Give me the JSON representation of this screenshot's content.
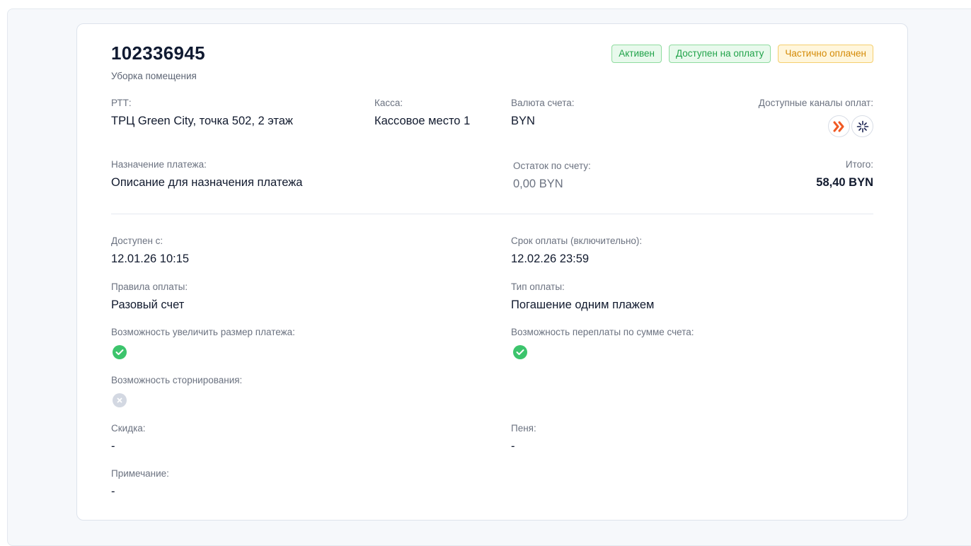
{
  "invoice": {
    "number": "102336945",
    "title": "Уборка помещения"
  },
  "badges": [
    {
      "label": "Активен",
      "color": "#21a34a"
    },
    {
      "label": "Доступен на оплату",
      "color": "#21a34a"
    },
    {
      "label": "Частично оплачен",
      "color": "#d48a06"
    }
  ],
  "fields": {
    "rtt": {
      "label": "РТТ:",
      "value": "ТРЦ Green City, точка 502, 2 этаж"
    },
    "kassa": {
      "label": "Касса:",
      "value": "Кассовое место 1"
    },
    "currency": {
      "label": "Валюта счета:",
      "value": "BYN"
    },
    "channels": {
      "label": "Доступные каналы оплат:",
      "icons": [
        "express-pay-icon",
        "star-burst-icon"
      ]
    },
    "purpose": {
      "label": "Назначение платежа:",
      "value": "Описание для назначения платежа"
    },
    "balance": {
      "label": "Остаток по счету:",
      "value": "0,00 BYN"
    },
    "total": {
      "label": "Итого:",
      "value": "58,40 BYN"
    }
  },
  "details": {
    "available_from": {
      "label": "Доступен с:",
      "value": "12.01.26 10:15"
    },
    "due_date": {
      "label": "Срок оплаты (включительно):",
      "value": "12.02.26 23:59"
    },
    "payment_rules": {
      "label": "Правила оплаты:",
      "value": "Разовый счет"
    },
    "payment_type": {
      "label": "Тип оплаты:",
      "value": "Погашение одним плажем"
    },
    "increase_payment": {
      "label": "Возможность увеличить размер платежа:",
      "state": "check-icon"
    },
    "overpayment": {
      "label": "Возможность переплаты по сумме счета:",
      "state": "check-icon"
    },
    "reversal": {
      "label": "Возможность сторнирования:",
      "state": "cross-icon"
    },
    "discount": {
      "label": "Скидка:",
      "value": "-"
    },
    "penalty": {
      "label": "Пеня:",
      "value": "-"
    },
    "note": {
      "label": "Примечание:",
      "value": "-"
    }
  },
  "colors": {
    "success": "#3cc46c",
    "disabled": "#d3d8e2",
    "accent_orange": "#f05a24",
    "accent_navy": "#1c2452"
  }
}
